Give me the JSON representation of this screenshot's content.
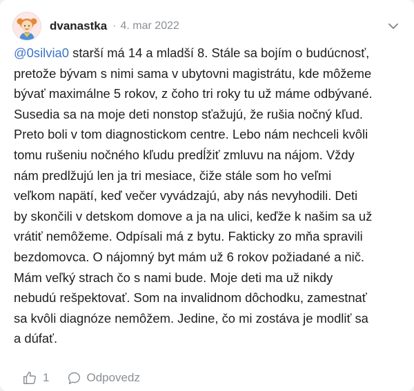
{
  "comment": {
    "author": "dvanastka",
    "separator": "·",
    "date": "4. mar 2022",
    "mention": "@0silvia0",
    "lines": [
      " starší má 14 a mladší 8. Stále sa bojím o budúcnosť,",
      "pretože bývam s nimi sama v ubytovni magistrátu, kde môžeme",
      "bývať maximálne 5 rokov, z čoho tri roky tu už máme odbývané.",
      "Susedia sa na moje deti nonstop sťažujú, že rušia nočný kľud.",
      "Preto boli v tom diagnostickom centre. Lebo nám nechceli kvôli",
      "tomu rušeniu nočného kľudu predĺžiť zmluvu na nájom. Vždy",
      "nám predlžujú len ja tri mesiace, čiže stále som ho veľmi",
      "veľkom napätí, keď večer vyvádzajú, aby nás nevyhodili. Deti",
      "by skončili v detskom domove a ja na ulici, keďže k našim sa už",
      "vrátiť nemôžeme. Odpísali má z bytu. Fakticky zo mňa spravili",
      "bezdomovca. O nájomný byt mám už 6 rokov požiadané a nič.",
      "Mám veľký strach čo s nami bude. Moje deti ma už nikdy",
      "nebudú rešpektovať. Som na invalidnom dôchodku, zamestnať",
      "sa kvôli diagnóze nemôžem. Jedine, čo mi zostáva je modliť sa",
      "a dúfať."
    ],
    "like_count": "1",
    "reply_label": "Odpovedz"
  },
  "icons": {
    "avatar": "girl-avatar-icon",
    "more": "chevron-down-icon",
    "like": "thumbs-up-icon",
    "reply": "speech-bubble-icon"
  },
  "colors": {
    "mention": "#3a74c7",
    "text": "#1e1e1e",
    "meta": "#8a8f95",
    "background": "#f0f0f0",
    "card": "#ffffff"
  }
}
